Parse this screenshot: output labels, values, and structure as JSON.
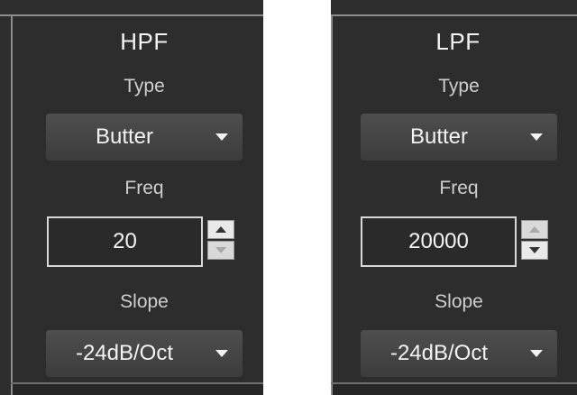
{
  "hpf": {
    "title": "HPF",
    "type_label": "Type",
    "type_value": "Butter",
    "freq_label": "Freq",
    "freq_value": "20",
    "slope_label": "Slope",
    "slope_value": "-24dB/Oct"
  },
  "lpf": {
    "title": "LPF",
    "type_label": "Type",
    "type_value": "Butter",
    "freq_label": "Freq",
    "freq_value": "20000",
    "slope_label": "Slope",
    "slope_value": "-24dB/Oct"
  },
  "icons": {
    "dropdown": "chevron-down-icon",
    "spin_up": "spin-up-icon",
    "spin_down": "spin-down-icon"
  },
  "colors": {
    "panel_bg": "#2d2d2d",
    "border": "#8c8c8c",
    "text": "#f4f4f4",
    "label_text": "#cfcfcf"
  }
}
